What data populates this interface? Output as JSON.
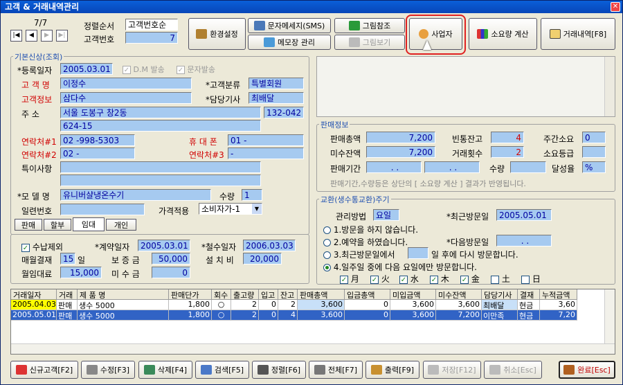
{
  "title": "고객 & 거래내역관리",
  "nav": {
    "record": "7/7"
  },
  "sort": {
    "label": "정렬순서",
    "value": "고객번호순",
    "cust_no_label": "고객번호",
    "cust_no": "7"
  },
  "toolbar": {
    "env": "환경설정",
    "sms": "문자메세지(SMS)",
    "memo": "메모장 관리",
    "pic_ref": "그림참조",
    "pic_view": "그림보기",
    "biz": "사업자",
    "consume": "소요량 계산",
    "history": "거래내역[F8]"
  },
  "basic": {
    "group": "기본신상(조회)",
    "reg_date_label": "*등록일자",
    "reg_date": "2005.03.01",
    "dm": "D.M 발송",
    "sms_send": "문자발송",
    "name_label": "고 객 명",
    "name": "이정수",
    "cat_label": "*고객분류",
    "cat": "특별회원",
    "info_label": "고객정보",
    "info": "삼다수",
    "tech_label": "*담당기사",
    "tech": "최배달",
    "addr_label": "주    소",
    "addr1": "서울 도봉구 창2동",
    "zip": "132-042",
    "addr2": "624-15",
    "tel1_label": "연락처#1",
    "tel1": "02 -998-5303",
    "mobile_label": "휴 대 폰",
    "mobile": "01 -",
    "tel2_label": "연락처#2",
    "tel2": "02 -",
    "tel3_label": "연락처#3",
    "tel3": "-",
    "note_label": "특이사항",
    "model_label": "*모 델 명",
    "model": "유니버샬냉온수기",
    "qty_label": "수량",
    "qty": "1",
    "serial_label": "일련번호",
    "price_label": "가격적용",
    "price": "소비자가-1",
    "tabs": [
      "판매",
      "할부",
      "임대",
      "개인"
    ],
    "active_tab": "임대"
  },
  "rent": {
    "exclude": "수납제외",
    "contract_label": "*계약일자",
    "contract": "2005.03.01",
    "withdraw_label": "*철수일자",
    "withdraw": "2006.03.03",
    "settle_label": "매월결재",
    "settle": "15",
    "settle_unit": "일",
    "deposit_label": "보 증 금",
    "deposit": "50,000",
    "install_label": "설 치 비",
    "install": "20,000",
    "monthly_label": "월임대료",
    "monthly": "15,000",
    "unpaid_label": "미 수 금",
    "unpaid": "0"
  },
  "sales": {
    "group": "판매정보",
    "total_label": "판매총액",
    "total": "7,200",
    "bottle_label": "빈통잔고",
    "bottle": "4",
    "weekly_label": "주간소요",
    "weekly": "0",
    "recv_label": "미수잔액",
    "recv": "7,200",
    "count_label": "거래횟수",
    "count": "2",
    "grade_label": "소요등급",
    "period_label": "판매기간",
    "qty_label": "수량",
    "achieve_label": "달성율",
    "achieve": "%",
    "note": "판매기간,수량등은 상단의 [ 소요량 계산 ] 결과가 반영됩니다."
  },
  "cycle": {
    "group": "교환(생수통교환)주기",
    "method_label": "관리방법",
    "method": "요일",
    "last_label": "*최근방문일",
    "last": "2005.05.01",
    "next_label": "*다음방문일",
    "next": ". .",
    "opt1": "1.방문을 하지 않습니다.",
    "opt2": "2.예약을 하였습니다.",
    "opt3a": "3.최근방문일에서",
    "opt3b": "일 후에 다시 방문합니다.",
    "opt4": "4.일주일 중에 다음 요일에만 방문합니다.",
    "days": [
      "月",
      "火",
      "水",
      "木",
      "金",
      "土",
      "日"
    ],
    "days_on": [
      true,
      true,
      true,
      true,
      true,
      false,
      false
    ]
  },
  "table": {
    "headers": [
      "거래일자",
      "거래",
      "제 품 명",
      "판매단가",
      "회수",
      "출고량",
      "입고",
      "잔고",
      "판매총액",
      "입금총액",
      "미입금액",
      "미수잔액",
      "담당기사",
      "결재",
      "누적금액"
    ],
    "rows": [
      [
        "2005.04.03",
        "판매",
        "생수 5000",
        "1,800",
        "○",
        "2",
        "0",
        "2",
        "3,600",
        "0",
        "3,600",
        "3,600",
        "최배달",
        "현금",
        "3,60"
      ],
      [
        "2005.05.01",
        "판매",
        "생수 5000",
        "1,800",
        "○",
        "2",
        "0",
        "4",
        "3,600",
        "0",
        "3,600",
        "7,200",
        "이만족",
        "현금",
        "7,20"
      ]
    ]
  },
  "bottom": {
    "new": "신규고객[F2]",
    "edit": "수정[F3]",
    "del": "삭제[F4]",
    "search": "검색[F5]",
    "sort": "정렬[F6]",
    "all": "전체[F7]",
    "print": "출력[F9]",
    "save": "저장[F12]",
    "cancel": "취소[Esc]",
    "done": "완료[Esc]"
  }
}
